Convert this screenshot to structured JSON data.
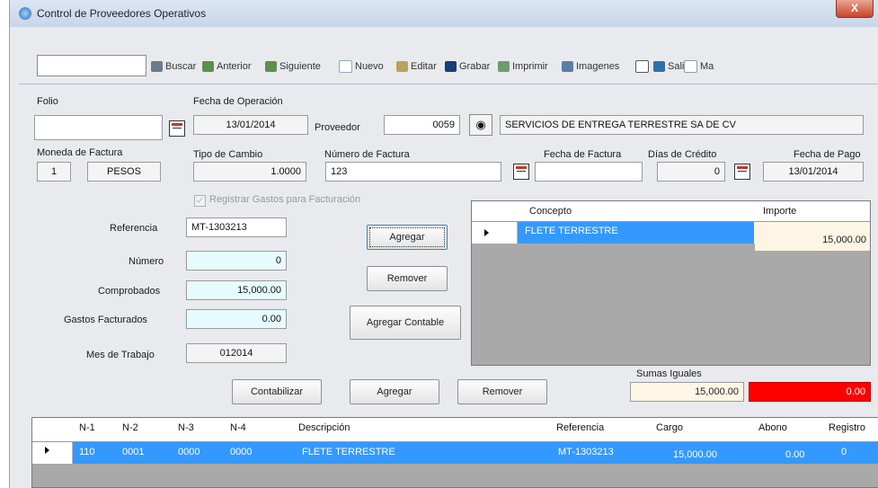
{
  "window": {
    "title": "Control de Proveedores Operativos",
    "close_label": "X"
  },
  "toolbar": {
    "items": [
      {
        "label": "Buscar",
        "color": "#6b7a8f"
      },
      {
        "label": "Anterior",
        "color": "#5d8f4e"
      },
      {
        "label": "Siguiente",
        "color": "#5d8f4e"
      },
      {
        "label": "Nuevo",
        "color": "#8fa6c0"
      },
      {
        "label": "Editar",
        "color": "#b9a35a"
      },
      {
        "label": "Grabar",
        "color": "#1b3b7a"
      },
      {
        "label": "Imprimir",
        "color": "#6f9a6f"
      },
      {
        "label": "Imagenes",
        "color": "#5a7fa6"
      },
      {
        "label": "Salir",
        "color": "#2f6fa8"
      },
      {
        "label": "Ma",
        "color": "#c9c9c9"
      }
    ]
  },
  "form": {
    "folio": {
      "label": "Folio",
      "value": ""
    },
    "fecha_operacion": {
      "label": "Fecha de Operación",
      "value": "13/01/2014"
    },
    "proveedor": {
      "label": "Proveedor",
      "code": "0059",
      "name": "SERVICIOS DE ENTREGA TERRESTRE SA DE CV"
    },
    "moneda": {
      "label": "Moneda de Factura",
      "code": "1",
      "name": "PESOS"
    },
    "tipo_cambio": {
      "label": "Tipo de Cambio",
      "value": "1.0000"
    },
    "numero_factura": {
      "label": "Número de Factura",
      "value": "123"
    },
    "fecha_factura": {
      "label": "Fecha de Factura",
      "value": ""
    },
    "dias_credito": {
      "label": "Días de Crédito",
      "value": "0"
    },
    "fecha_pago": {
      "label": "Fecha de Pago",
      "value": "13/01/2014"
    },
    "registrar_gastos": {
      "label": "Registrar Gastos para Facturación"
    },
    "referencia": {
      "label": "Referencia",
      "value": "MT-1303213"
    },
    "numero": {
      "label": "Número",
      "value": "0"
    },
    "comprobados": {
      "label": "Comprobados",
      "value": "15,000.00"
    },
    "gastos_facturados": {
      "label": "Gastos Facturados",
      "value": "0.00"
    },
    "mes_trabajo": {
      "label": "Mes de Trabajo",
      "value": "012014"
    }
  },
  "buttons": {
    "agregar1": "Agregar",
    "remover1": "Remover",
    "agregar_contable": "Agregar Contable",
    "contabilizar": "Contabilizar",
    "agregar2": "Agregar",
    "remover2": "Remover"
  },
  "conceptos": {
    "headers": [
      "Concepto",
      "Importe"
    ],
    "rows": [
      {
        "concepto": "FLETE TERRESTRE",
        "importe": "15,000.00"
      }
    ]
  },
  "sumas": {
    "label": "Sumas Iguales",
    "total": "15,000.00",
    "diferencia": "0.00"
  },
  "poliza": {
    "headers": [
      "N-1",
      "N-2",
      "N-3",
      "N-4",
      "Descripción",
      "Referencia",
      "Cargo",
      "Abono",
      "Registro"
    ],
    "rows": [
      {
        "n1": "110",
        "n2": "0001",
        "n3": "0000",
        "n4": "0000",
        "descripcion": "FLETE TERRESTRE",
        "referencia": "MT-1303213",
        "cargo": "15,000.00",
        "abono": "0.00",
        "registro": "0"
      }
    ]
  },
  "colors": {
    "selection": "#3399ff",
    "difference": "#ff0000",
    "highlight_cell": "#fdf6e4"
  }
}
